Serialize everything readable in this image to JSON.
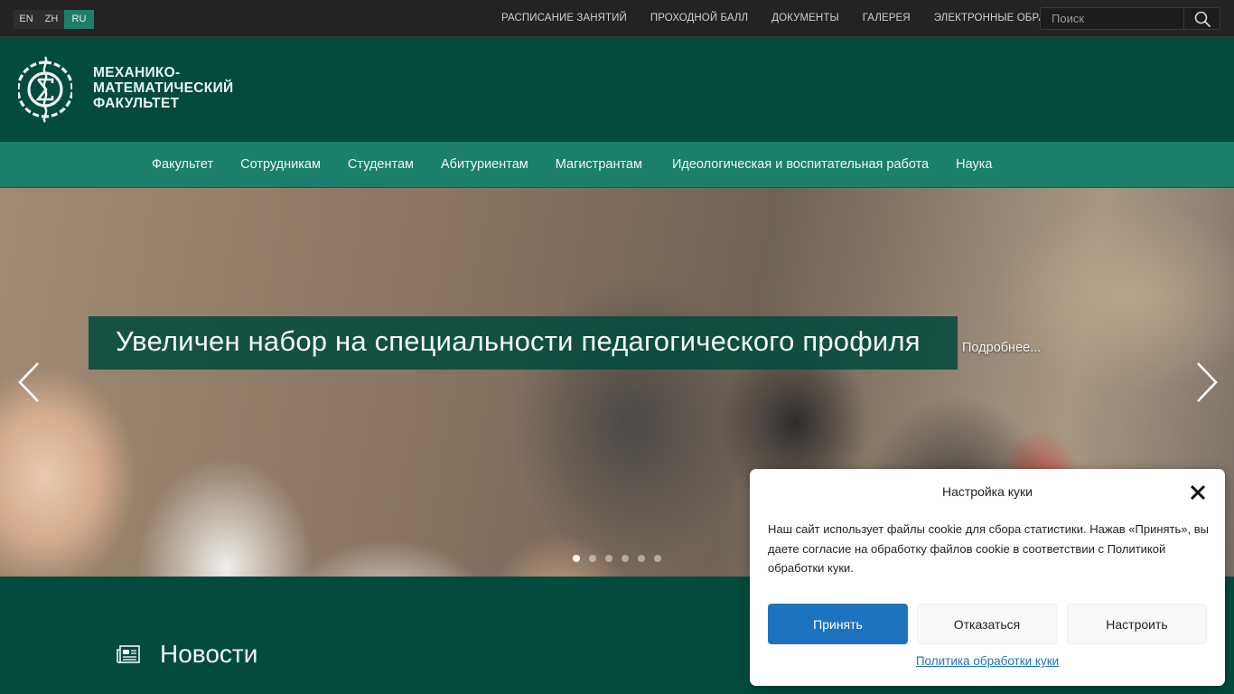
{
  "languages": [
    {
      "code": "EN",
      "active": false
    },
    {
      "code": "ZH",
      "active": false
    },
    {
      "code": "RU",
      "active": true
    }
  ],
  "topnav": {
    "items": [
      "РАСПИСАНИЕ ЗАНЯТИЙ",
      "ПРОХОДНОЙ БАЛЛ",
      "ДОКУМЕНТЫ",
      "ГАЛЕРЕЯ",
      "ЭЛЕКТРОННЫЕ ОБРАЩЕНИЯ"
    ]
  },
  "search": {
    "placeholder": "Поиск",
    "icon": "search-icon"
  },
  "header": {
    "logo_icon": "sigma-gear-logo",
    "logo_lines": [
      "МЕХАНИКО-",
      "МАТЕМАТИЧЕСКИЙ",
      "ФАКУЛЬТЕТ"
    ]
  },
  "mainnav": {
    "items": [
      "Факультет",
      "Сотрудникам",
      "Студентам",
      "Абитуриентам",
      "Магистрантам",
      "Идеологическая и воспитательная работа",
      "Наука"
    ]
  },
  "hero": {
    "caption": "Увеличен набор на специальности педагогического профиля",
    "more_link": "Подробнее...",
    "slides_total": 6,
    "active_slide": 1,
    "prev_icon": "chevron-left-icon",
    "next_icon": "chevron-right-icon"
  },
  "news": {
    "title": "Новости",
    "icon": "newspaper-icon"
  },
  "cookie": {
    "title": "Настройка куки",
    "text": "Наш сайт использует файлы cookie для сбора статистики. Нажав «Принять», вы даете согласие на обработку файлов cookie в соответствии с Политикой обработки куки.",
    "accept_label": "Принять",
    "deny_label": "Отказаться",
    "prefs_label": "Настроить",
    "policy_link": "Политика обработки куки",
    "close_icon": "close-icon"
  },
  "colors": {
    "topbar": "#232323",
    "header": "#034b3d",
    "mainnav": "#1b7f69",
    "accept_button": "#1e73be"
  }
}
